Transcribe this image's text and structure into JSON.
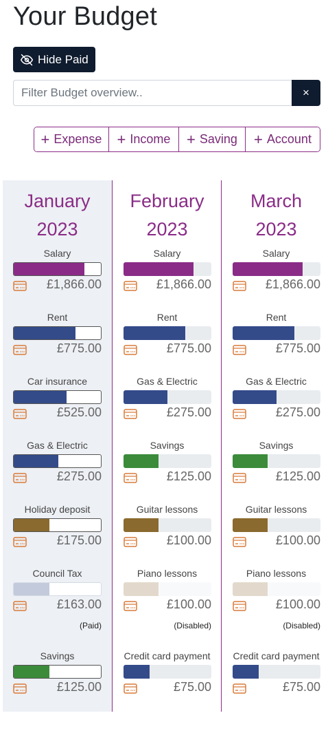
{
  "page": {
    "title": "Your Budget"
  },
  "toolbar": {
    "hide_paid_label": "Hide Paid",
    "filter_placeholder": "Filter Budget overview..",
    "filter_value": "",
    "clear_label": "×"
  },
  "add_buttons": [
    {
      "label": "Expense"
    },
    {
      "label": "Income"
    },
    {
      "label": "Saving"
    },
    {
      "label": "Account"
    }
  ],
  "colors": {
    "primary": "#8a2c87",
    "dark": "#0f1b2e",
    "income": "#8a2c87",
    "expense": "#344b8a",
    "saving": "#3b8b3b",
    "fun": "#8a6a2e",
    "icon": "#d97b3a"
  },
  "months": [
    {
      "name": "January",
      "year": "2023",
      "items": [
        {
          "label": "Salary",
          "amount": "£1,866.00",
          "fill": 0.81,
          "color": "#8a2c87",
          "note": ""
        },
        {
          "label": "Rent",
          "amount": "£775.00",
          "fill": 0.71,
          "color": "#344b8a",
          "note": ""
        },
        {
          "label": "Car insurance",
          "amount": "£525.00",
          "fill": 0.61,
          "color": "#344b8a",
          "note": ""
        },
        {
          "label": "Gas & Electric",
          "amount": "£275.00",
          "fill": 0.51,
          "color": "#344b8a",
          "note": ""
        },
        {
          "label": "Holiday deposit",
          "amount": "£175.00",
          "fill": 0.41,
          "color": "#8a6a2e",
          "note": ""
        },
        {
          "label": "Council Tax",
          "amount": "£163.00",
          "fill": 0.41,
          "color": "#c3cadb",
          "note": "(Paid)"
        },
        {
          "label": "Savings",
          "amount": "£125.00",
          "fill": 0.41,
          "color": "#3b8b3b",
          "note": ""
        }
      ]
    },
    {
      "name": "February",
      "year": "2023",
      "items": [
        {
          "label": "Salary",
          "amount": "£1,866.00",
          "fill": 0.8,
          "color": "#8a2c87",
          "note": ""
        },
        {
          "label": "Rent",
          "amount": "£775.00",
          "fill": 0.7,
          "color": "#344b8a",
          "note": ""
        },
        {
          "label": "Gas & Electric",
          "amount": "£275.00",
          "fill": 0.5,
          "color": "#344b8a",
          "note": ""
        },
        {
          "label": "Savings",
          "amount": "£125.00",
          "fill": 0.4,
          "color": "#3b8b3b",
          "note": ""
        },
        {
          "label": "Guitar lessons",
          "amount": "£100.00",
          "fill": 0.4,
          "color": "#8a6a2e",
          "note": ""
        },
        {
          "label": "Piano lessons",
          "amount": "£100.00",
          "fill": 0.4,
          "color": "#e2d9cc",
          "note": "(Disabled)"
        },
        {
          "label": "Credit card payment",
          "amount": "£75.00",
          "fill": 0.3,
          "color": "#344b8a",
          "note": ""
        }
      ]
    },
    {
      "name": "March",
      "year": "2023",
      "items": [
        {
          "label": "Salary",
          "amount": "£1,866.00",
          "fill": 0.8,
          "color": "#8a2c87",
          "note": ""
        },
        {
          "label": "Rent",
          "amount": "£775.00",
          "fill": 0.7,
          "color": "#344b8a",
          "note": ""
        },
        {
          "label": "Gas & Electric",
          "amount": "£275.00",
          "fill": 0.5,
          "color": "#344b8a",
          "note": ""
        },
        {
          "label": "Savings",
          "amount": "£125.00",
          "fill": 0.4,
          "color": "#3b8b3b",
          "note": ""
        },
        {
          "label": "Guitar lessons",
          "amount": "£100.00",
          "fill": 0.4,
          "color": "#8a6a2e",
          "note": ""
        },
        {
          "label": "Piano lessons",
          "amount": "£100.00",
          "fill": 0.4,
          "color": "#e2d9cc",
          "note": "(Disabled)"
        },
        {
          "label": "Credit card payment",
          "amount": "£75.00",
          "fill": 0.3,
          "color": "#344b8a",
          "note": ""
        }
      ]
    }
  ]
}
